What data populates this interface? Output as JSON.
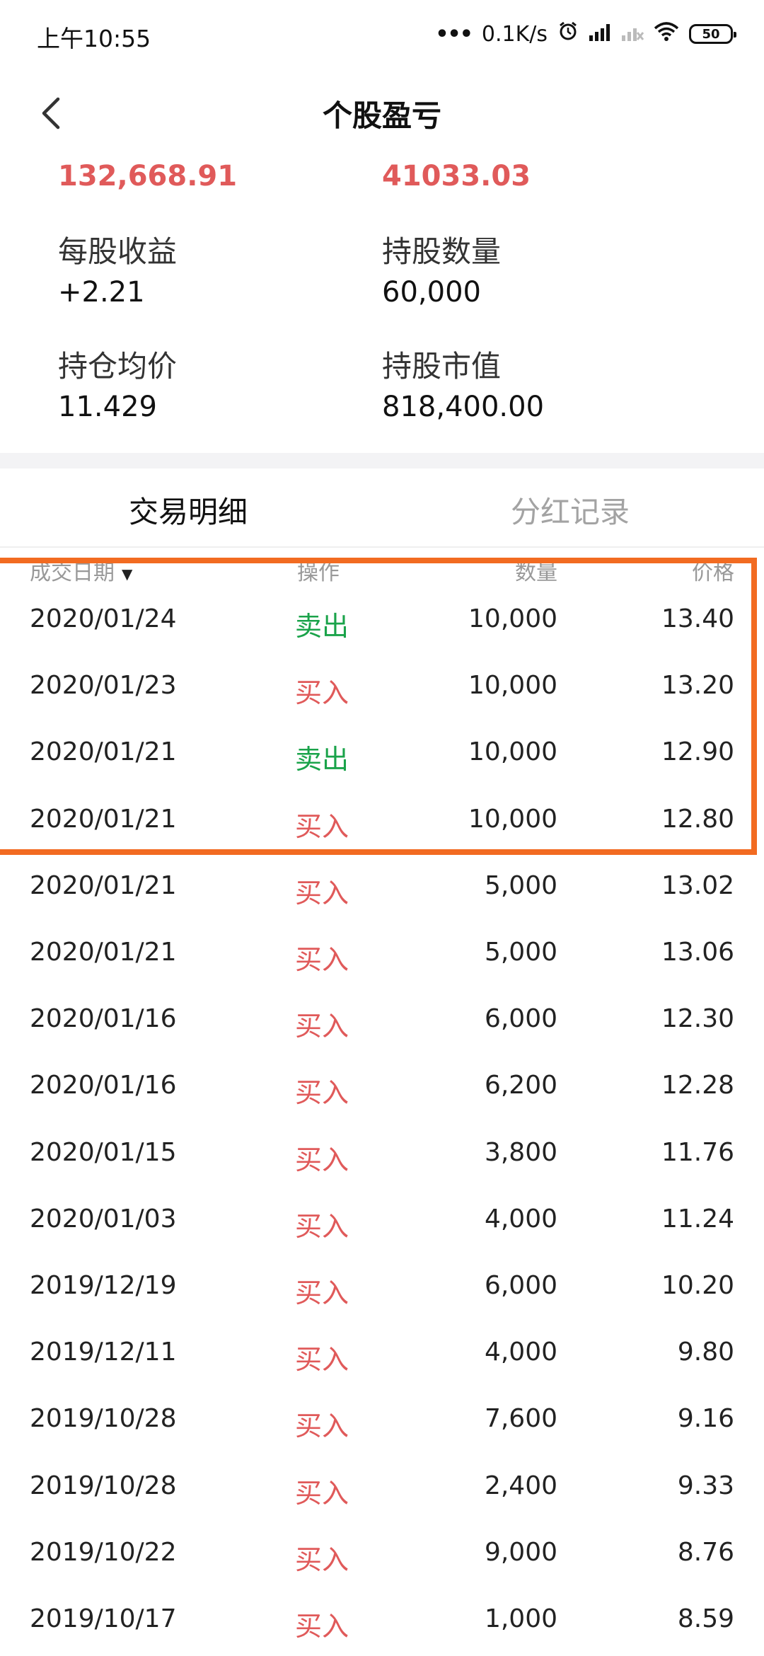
{
  "status_bar": {
    "time": "上午10:55",
    "network_speed": "0.1K/s",
    "battery": "50",
    "icons": [
      "dots-icon",
      "alarm-icon",
      "signal-icon",
      "signal-off-icon",
      "wifi-icon",
      "battery-icon"
    ]
  },
  "header": {
    "title": "个股盈亏",
    "back_icon": "chevron-left-icon"
  },
  "summary": {
    "left_top_value": "132,668.91",
    "right_top_value": "41033.03",
    "eps_label": "每股收益",
    "eps_value": "+2.21",
    "shares_label": "持股数量",
    "shares_value": "60,000",
    "avg_cost_label": "持仓均价",
    "avg_cost_value": "11.429",
    "market_value_label": "持股市值",
    "market_value_value": "818,400.00"
  },
  "tabs": [
    {
      "label": "交易明细",
      "active": true
    },
    {
      "label": "分红记录",
      "active": false
    }
  ],
  "table": {
    "headers": {
      "date": "成交日期",
      "operation": "操作",
      "quantity": "数量",
      "price": "价格"
    },
    "rows": [
      {
        "date": "2020/01/24",
        "op": "卖出",
        "qty": "10,000",
        "price": "13.40"
      },
      {
        "date": "2020/01/23",
        "op": "买入",
        "qty": "10,000",
        "price": "13.20"
      },
      {
        "date": "2020/01/21",
        "op": "卖出",
        "qty": "10,000",
        "price": "12.90"
      },
      {
        "date": "2020/01/21",
        "op": "买入",
        "qty": "10,000",
        "price": "12.80"
      },
      {
        "date": "2020/01/21",
        "op": "买入",
        "qty": "5,000",
        "price": "13.02"
      },
      {
        "date": "2020/01/21",
        "op": "买入",
        "qty": "5,000",
        "price": "13.06"
      },
      {
        "date": "2020/01/16",
        "op": "买入",
        "qty": "6,000",
        "price": "12.30"
      },
      {
        "date": "2020/01/16",
        "op": "买入",
        "qty": "6,200",
        "price": "12.28"
      },
      {
        "date": "2020/01/15",
        "op": "买入",
        "qty": "3,800",
        "price": "11.76"
      },
      {
        "date": "2020/01/03",
        "op": "买入",
        "qty": "4,000",
        "price": "11.24"
      },
      {
        "date": "2019/12/19",
        "op": "买入",
        "qty": "6,000",
        "price": "10.20"
      },
      {
        "date": "2019/12/11",
        "op": "买入",
        "qty": "4,000",
        "price": "9.80"
      },
      {
        "date": "2019/10/28",
        "op": "买入",
        "qty": "7,600",
        "price": "9.16"
      },
      {
        "date": "2019/10/28",
        "op": "买入",
        "qty": "2,400",
        "price": "9.33"
      },
      {
        "date": "2019/10/22",
        "op": "买入",
        "qty": "9,000",
        "price": "8.76"
      },
      {
        "date": "2019/10/17",
        "op": "买入",
        "qty": "1,000",
        "price": "8.59"
      }
    ]
  },
  "colors": {
    "buy": "#e05a5a",
    "sell": "#1aa34a",
    "highlight": "#f26b21",
    "summary_red": "#e05a5a"
  }
}
